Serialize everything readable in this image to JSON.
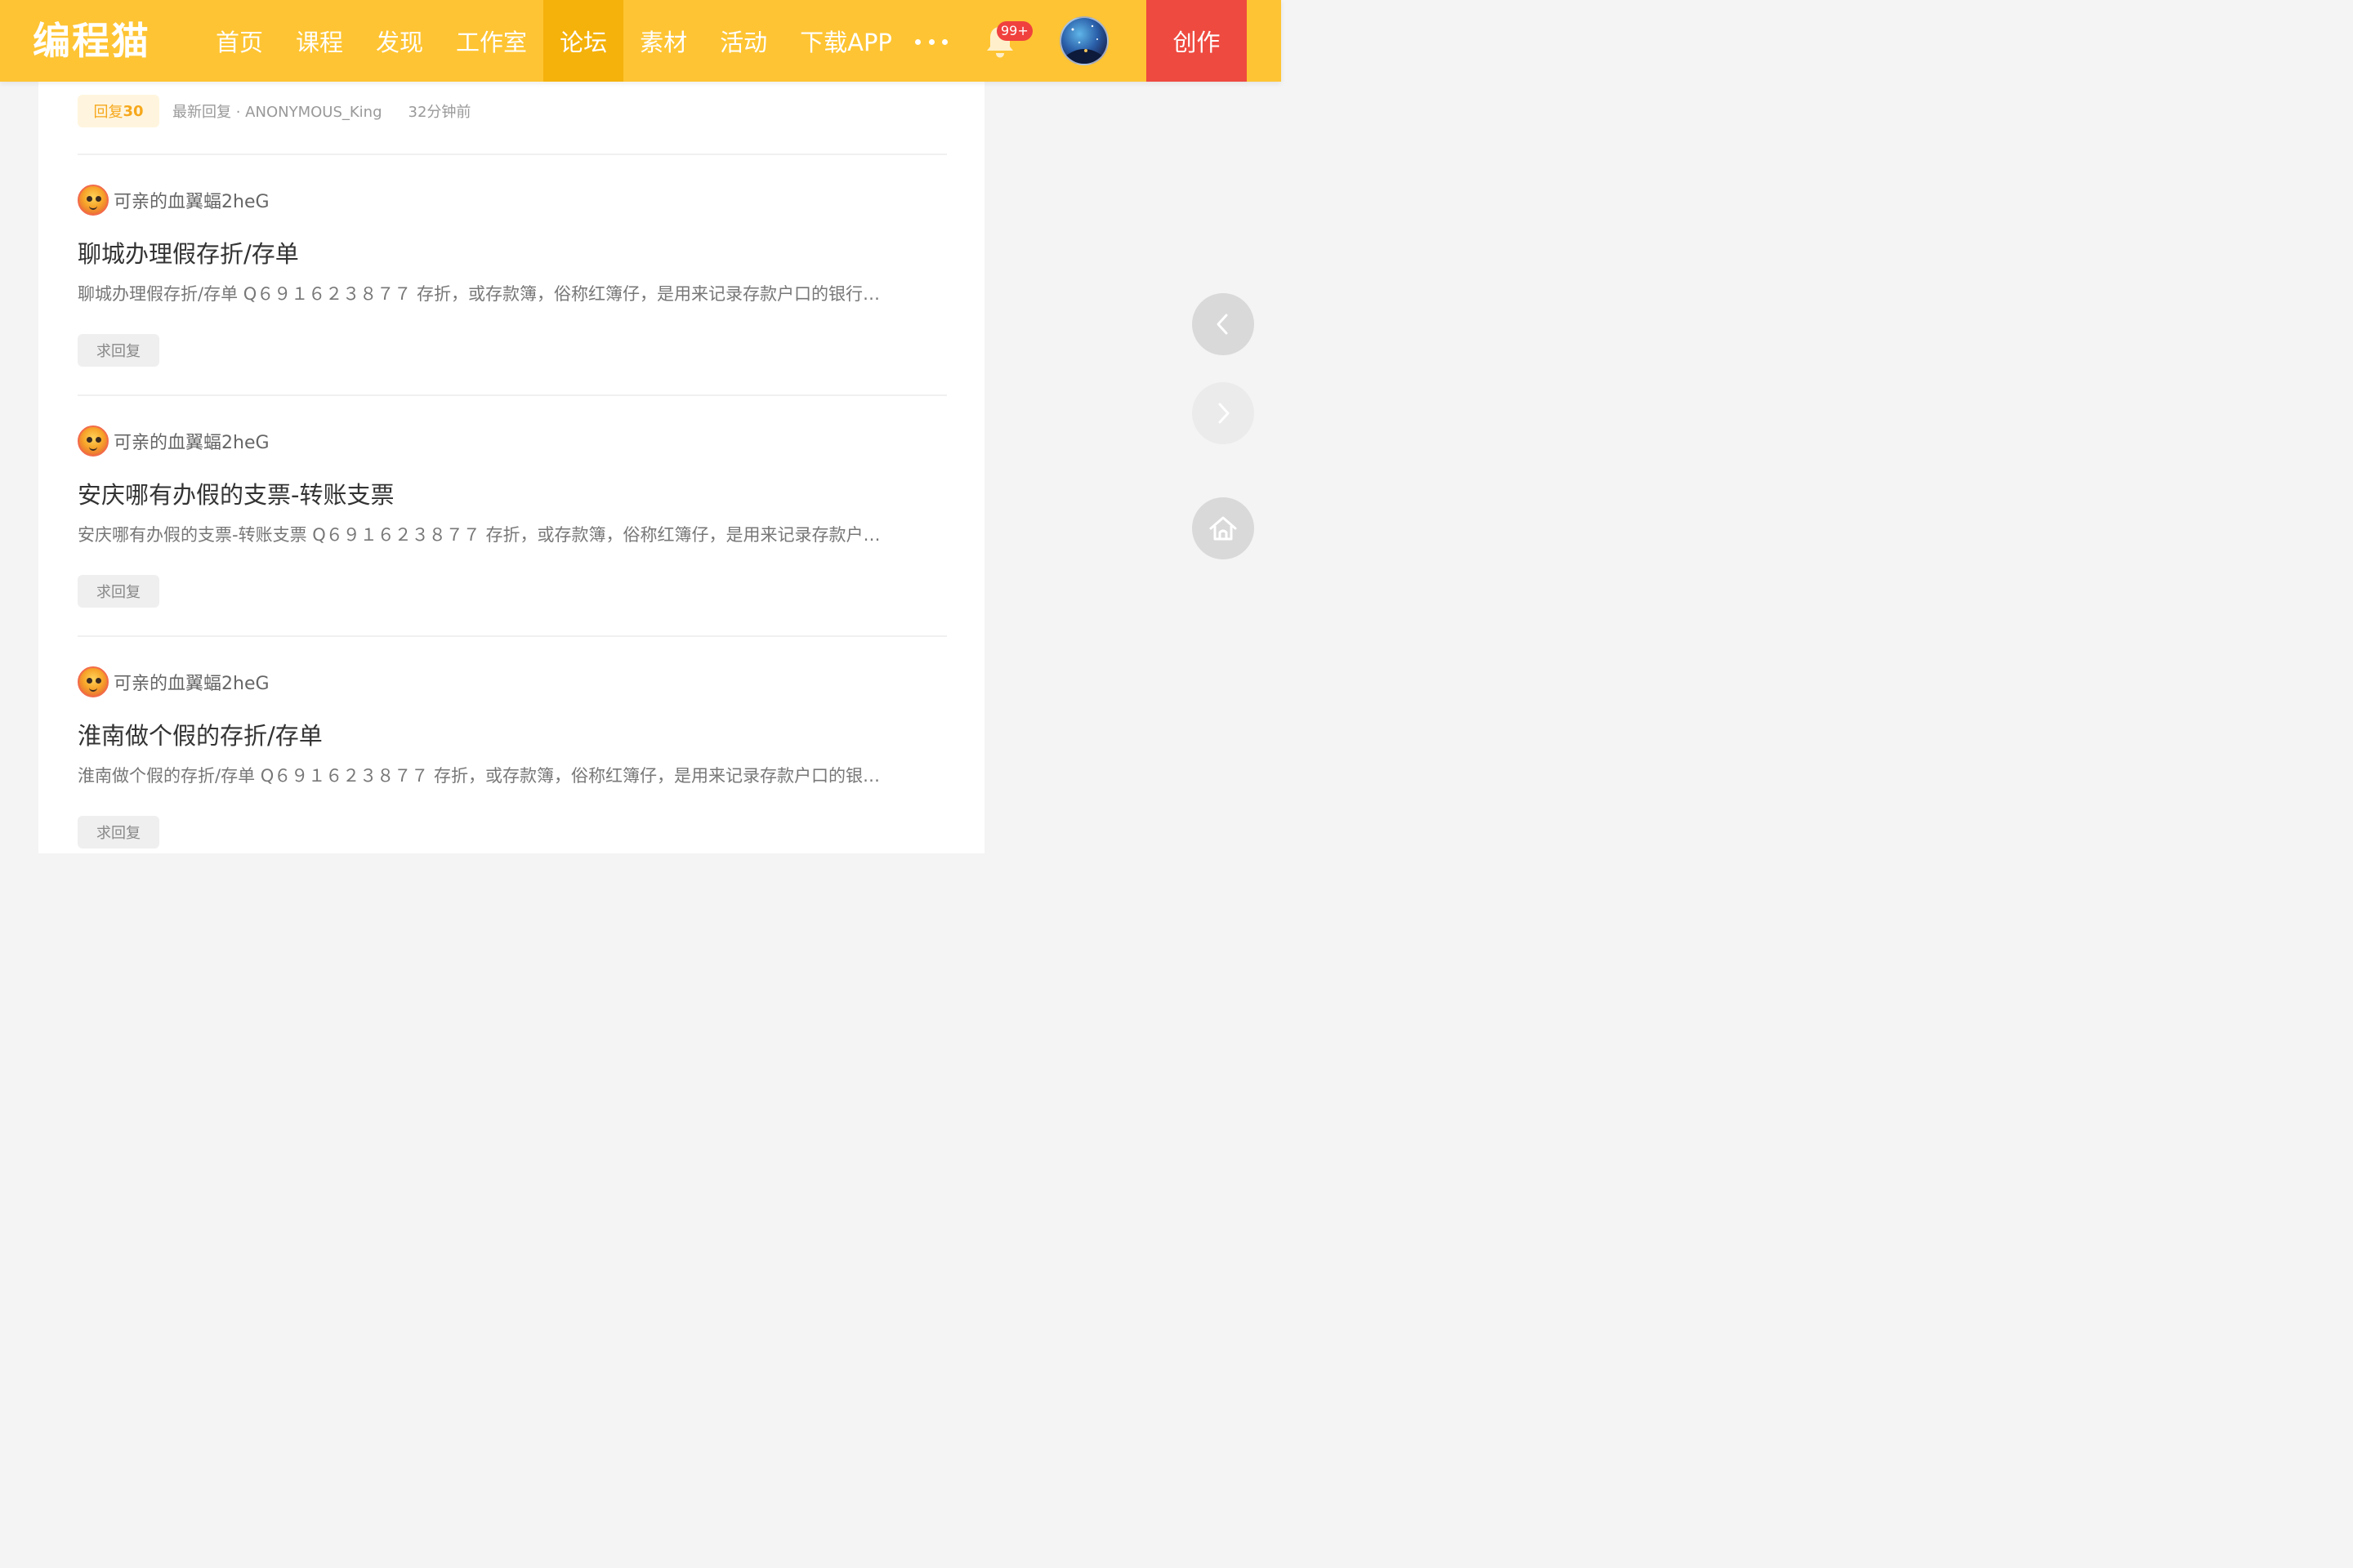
{
  "header": {
    "logo_text": "编程猫",
    "nav": [
      {
        "label": "首页",
        "active": false
      },
      {
        "label": "课程",
        "active": false
      },
      {
        "label": "发现",
        "active": false
      },
      {
        "label": "工作室",
        "active": false
      },
      {
        "label": "论坛",
        "active": true
      },
      {
        "label": "素材",
        "active": false
      },
      {
        "label": "活动",
        "active": false
      },
      {
        "label": "下载APP",
        "active": false
      }
    ],
    "more_icon": "more-dots-icon",
    "notification_icon": "bell-icon",
    "notification_count": "99+",
    "create_label": "创作",
    "colors": {
      "bar": "#fec433",
      "active": "#f5b20b",
      "create": "#ee4a40"
    }
  },
  "first_post_footer": {
    "reply_prefix": "回复",
    "reply_count": "30",
    "latest_reply": "最新回复 · ANONYMOUS_King",
    "time": "32分钟前"
  },
  "posts": [
    {
      "author": "可亲的血翼蝠2heG",
      "title": "聊城办理假存折/存单",
      "summary": "聊城办理假存折/存单 Q６９１６２３８７７ 存折，或存款簿，俗称红簿仔，是用来记录存款户口的银行…",
      "tag": "求回复"
    },
    {
      "author": "可亲的血翼蝠2heG",
      "title": "安庆哪有办假的支票-转账支票",
      "summary": "安庆哪有办假的支票-转账支票 Q６９１６２３８７７ 存折，或存款簿，俗称红簿仔，是用来记录存款户…",
      "tag": "求回复"
    },
    {
      "author": "可亲的血翼蝠2heG",
      "title": "淮南做个假的存折/存单",
      "summary": "淮南做个假的存折/存单 Q６９１６２３８７７ 存折，或存款簿，俗称红簿仔，是用来记录存款户口的银…",
      "tag": "求回复"
    }
  ],
  "float_controls": {
    "prev_icon": "chevron-left-icon",
    "next_icon": "chevron-right-icon",
    "home_icon": "home-icon"
  }
}
